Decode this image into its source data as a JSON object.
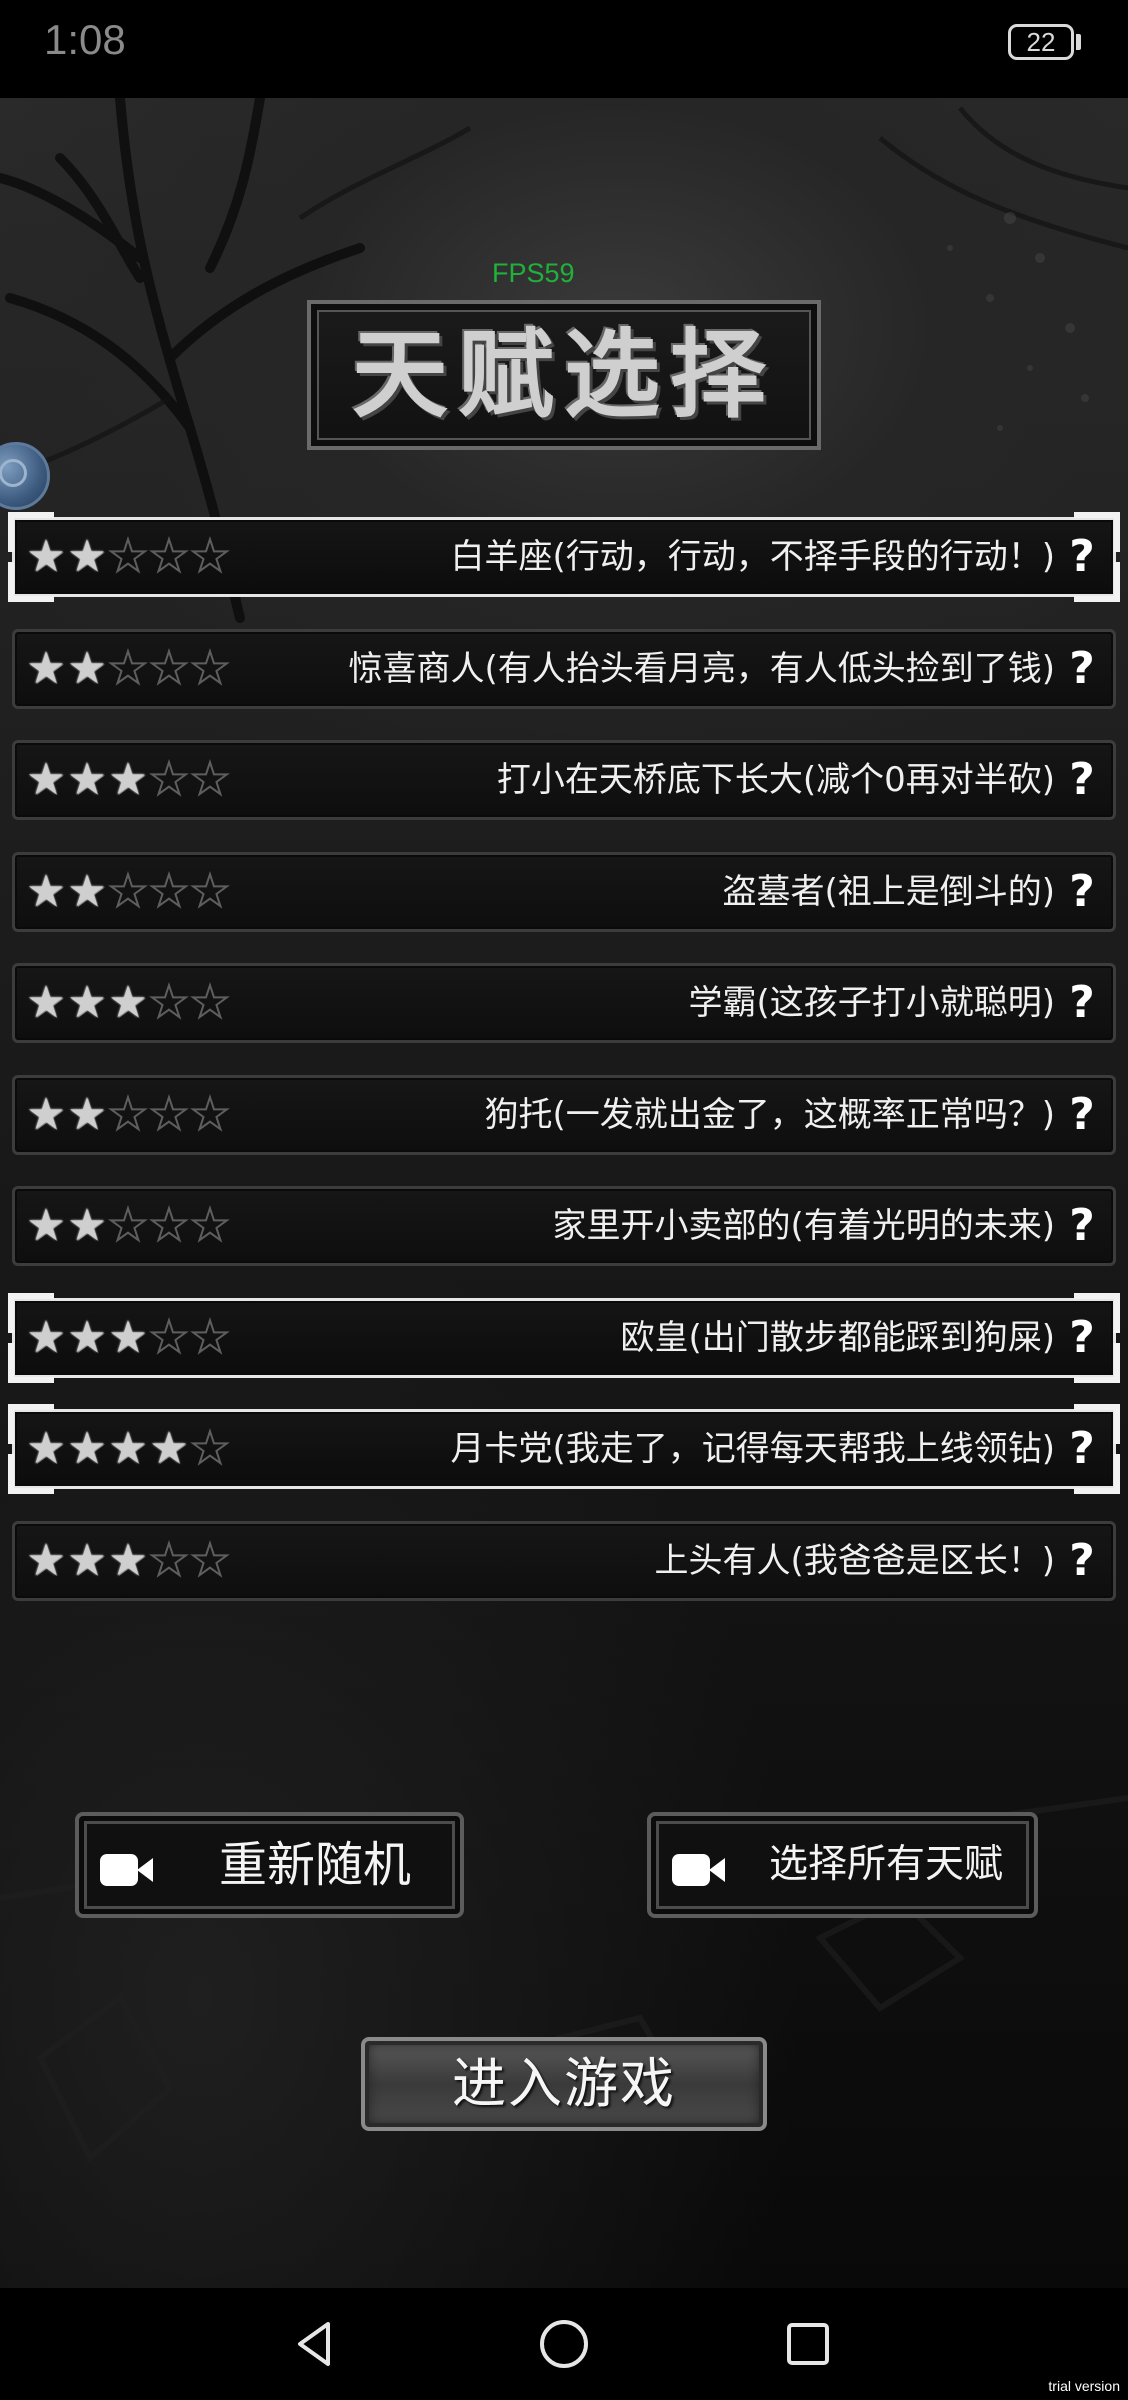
{
  "status_bar": {
    "time": "1:08",
    "battery": "22"
  },
  "header": {
    "fps": "FPS59",
    "title": "天赋选择"
  },
  "talents": [
    {
      "label": "白羊座(行动，行动，不择手段的行动！)",
      "stars": 2,
      "max_stars": 5,
      "selected": true
    },
    {
      "label": "惊喜商人(有人抬头看月亮，有人低头捡到了钱)",
      "stars": 2,
      "max_stars": 5,
      "selected": false
    },
    {
      "label": "打小在天桥底下长大(减个0再对半砍)",
      "stars": 3,
      "max_stars": 5,
      "selected": false
    },
    {
      "label": "盗墓者(祖上是倒斗的)",
      "stars": 2,
      "max_stars": 5,
      "selected": false
    },
    {
      "label": "学霸(这孩子打小就聪明)",
      "stars": 3,
      "max_stars": 5,
      "selected": false
    },
    {
      "label": "狗托(一发就出金了，这概率正常吗？)",
      "stars": 2,
      "max_stars": 5,
      "selected": false
    },
    {
      "label": "家里开小卖部的(有着光明的未来)",
      "stars": 2,
      "max_stars": 5,
      "selected": false
    },
    {
      "label": "欧皇(出门散步都能踩到狗屎)",
      "stars": 3,
      "max_stars": 5,
      "selected": true
    },
    {
      "label": "月卡党(我走了，记得每天帮我上线领钻)",
      "stars": 4,
      "max_stars": 5,
      "selected": true
    },
    {
      "label": "上头有人(我爸爸是区长！)",
      "stars": 3,
      "max_stars": 5,
      "selected": false
    }
  ],
  "help_glyph": "?",
  "buttons": {
    "reroll": "重新随机",
    "select_all": "选择所有天赋",
    "enter_game": "进入游戏"
  },
  "icons": {
    "video": "video-camera-icon",
    "star": "star-icon",
    "help": "question-mark-icon"
  },
  "watermark": "trial version"
}
